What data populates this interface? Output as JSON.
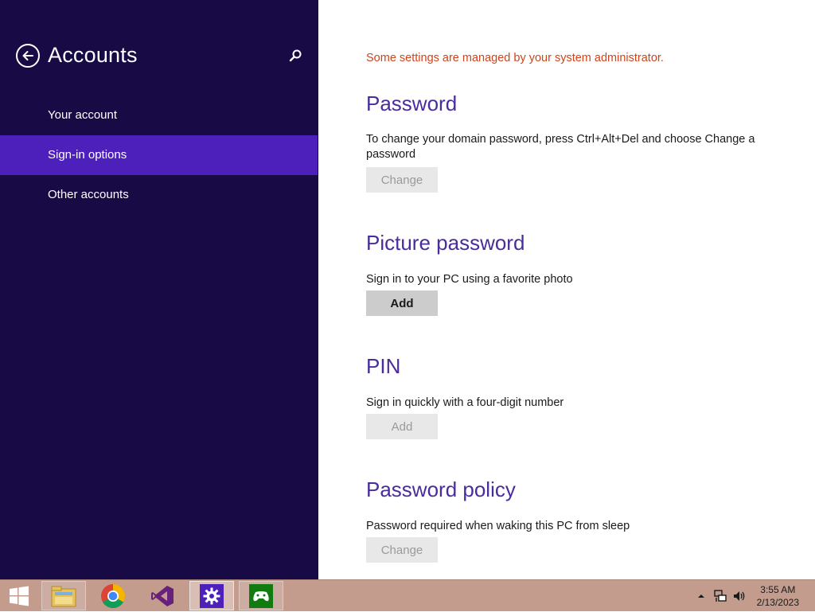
{
  "sidebar": {
    "title": "Accounts",
    "items": [
      {
        "label": "Your account",
        "active": false
      },
      {
        "label": "Sign-in options",
        "active": true
      },
      {
        "label": "Other accounts",
        "active": false
      }
    ],
    "colors": {
      "background": "#180a44",
      "active": "#4d1fbb"
    }
  },
  "main": {
    "notice": "Some settings are managed by your system administrator.",
    "sections": [
      {
        "title": "Password",
        "description": "To change your domain password, press Ctrl+Alt+Del and choose Change a password",
        "button": "Change",
        "button_enabled": false
      },
      {
        "title": "Picture password",
        "description": "Sign in to your PC using a favorite photo",
        "button": "Add",
        "button_enabled": true
      },
      {
        "title": "PIN",
        "description": "Sign in quickly with a four-digit number",
        "button": "Add",
        "button_enabled": false
      },
      {
        "title": "Password policy",
        "description": "Password required when waking this PC from sleep",
        "button": "Change",
        "button_enabled": false
      }
    ],
    "colors": {
      "title": "#4a2c9c",
      "notice": "#d0431b"
    }
  },
  "taskbar": {
    "apps": [
      "file-explorer-icon",
      "chrome-icon",
      "visual-studio-icon",
      "settings-icon",
      "xbox-games-icon"
    ],
    "active_app": "settings-icon",
    "time": "3:55 AM",
    "date": "2/13/2023",
    "background": "#c39c8e"
  }
}
